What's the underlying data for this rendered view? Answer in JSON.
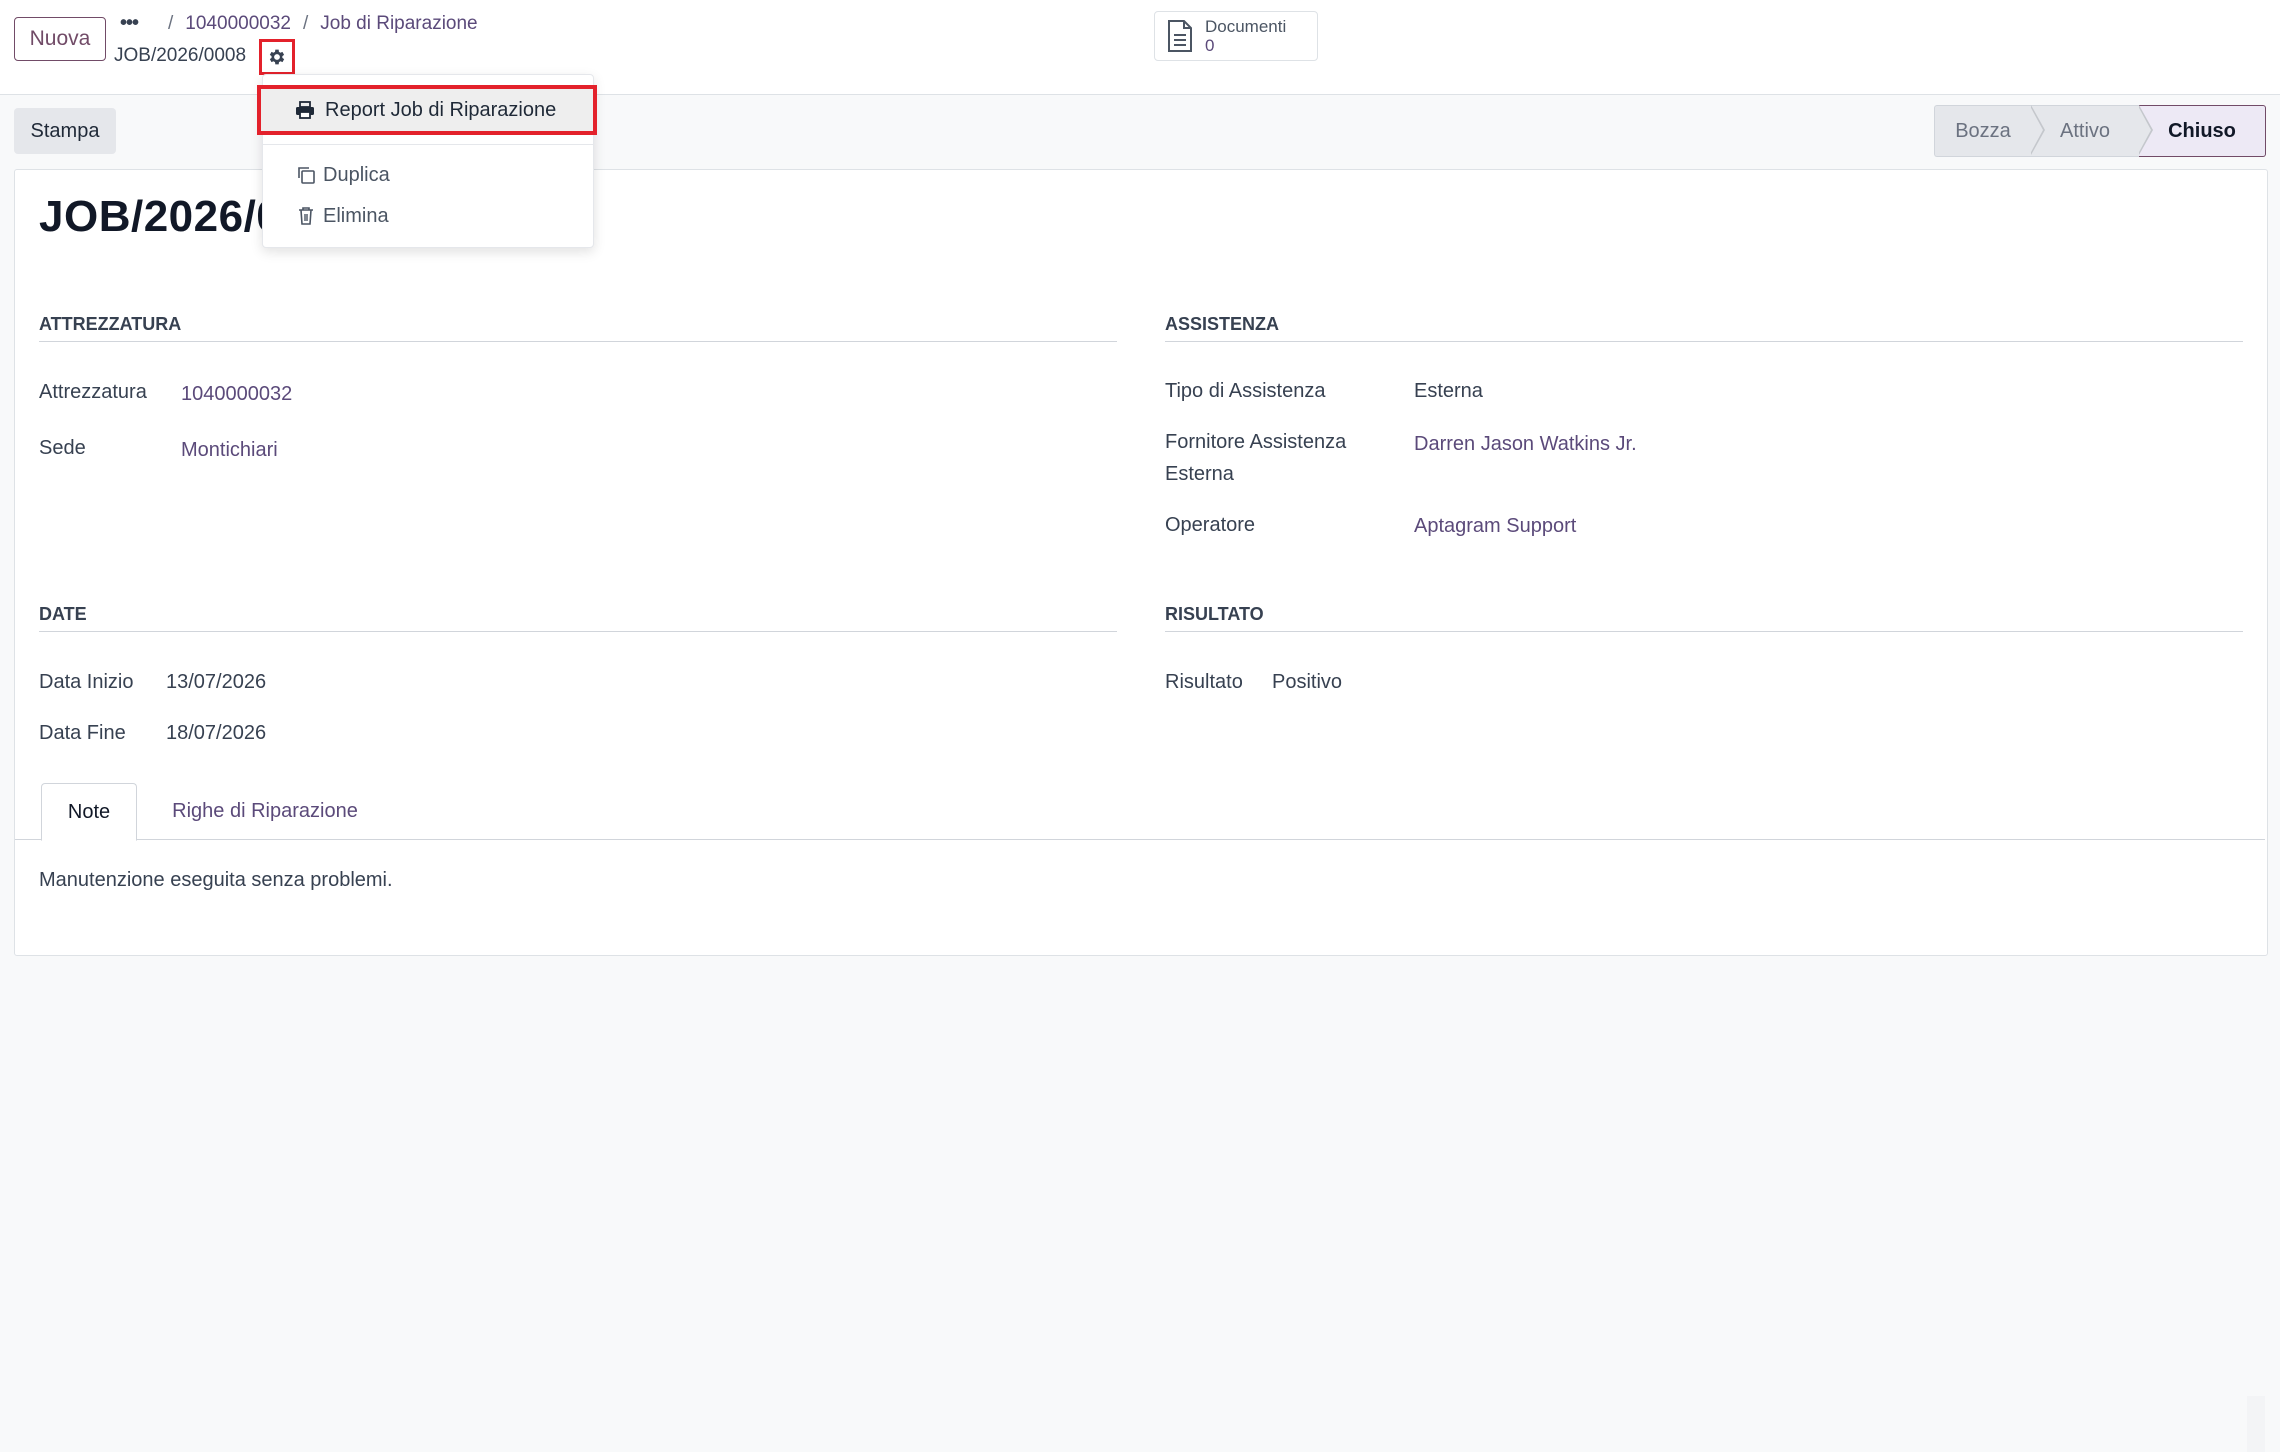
{
  "header": {
    "new_button": "Nuova",
    "breadcrumb": {
      "dots": "•••",
      "sep": "/",
      "parent": "1040000032",
      "current": "Job di Riparazione"
    },
    "record_name": "JOB/2026/0008",
    "documents": {
      "label": "Documenti",
      "count": "0"
    }
  },
  "actions": {
    "print_button": "Stampa",
    "statuses": [
      {
        "label": "Bozza",
        "active": false
      },
      {
        "label": "Attivo",
        "active": false
      },
      {
        "label": "Chiuso",
        "active": true
      }
    ]
  },
  "dropdown": {
    "report": "Report Job di Riparazione",
    "duplicate": "Duplica",
    "delete": "Elimina"
  },
  "form": {
    "title": "JOB/2026/0",
    "equipment_section": {
      "heading": "ATTREZZATURA",
      "equipment_label": "Attrezzatura",
      "equipment_value": "1040000032",
      "site_label": "Sede",
      "site_value": "Montichiari"
    },
    "assistance_section": {
      "heading": "ASSISTENZA",
      "type_label": "Tipo di Assistenza",
      "type_value": "Esterna",
      "supplier_label_1": "Fornitore Assistenza",
      "supplier_label_2": "Esterna",
      "supplier_value": "Darren Jason Watkins Jr.",
      "operator_label": "Operatore",
      "operator_value": "Aptagram Support"
    },
    "dates_section": {
      "heading": "DATE",
      "start_label": "Data Inizio",
      "start_value": "13/07/2026",
      "end_label": "Data Fine",
      "end_value": "18/07/2026"
    },
    "result_section": {
      "heading": "RISULTATO",
      "result_label": "Risultato",
      "result_value": "Positivo"
    },
    "tabs": [
      {
        "label": "Note",
        "active": true
      },
      {
        "label": "Righe di Riparazione",
        "active": false
      }
    ],
    "note_text": "Manutenzione eseguita senza problemi."
  },
  "colors": {
    "accent": "#714b67",
    "link": "#5b4a7a",
    "highlight": "#e3212b"
  }
}
